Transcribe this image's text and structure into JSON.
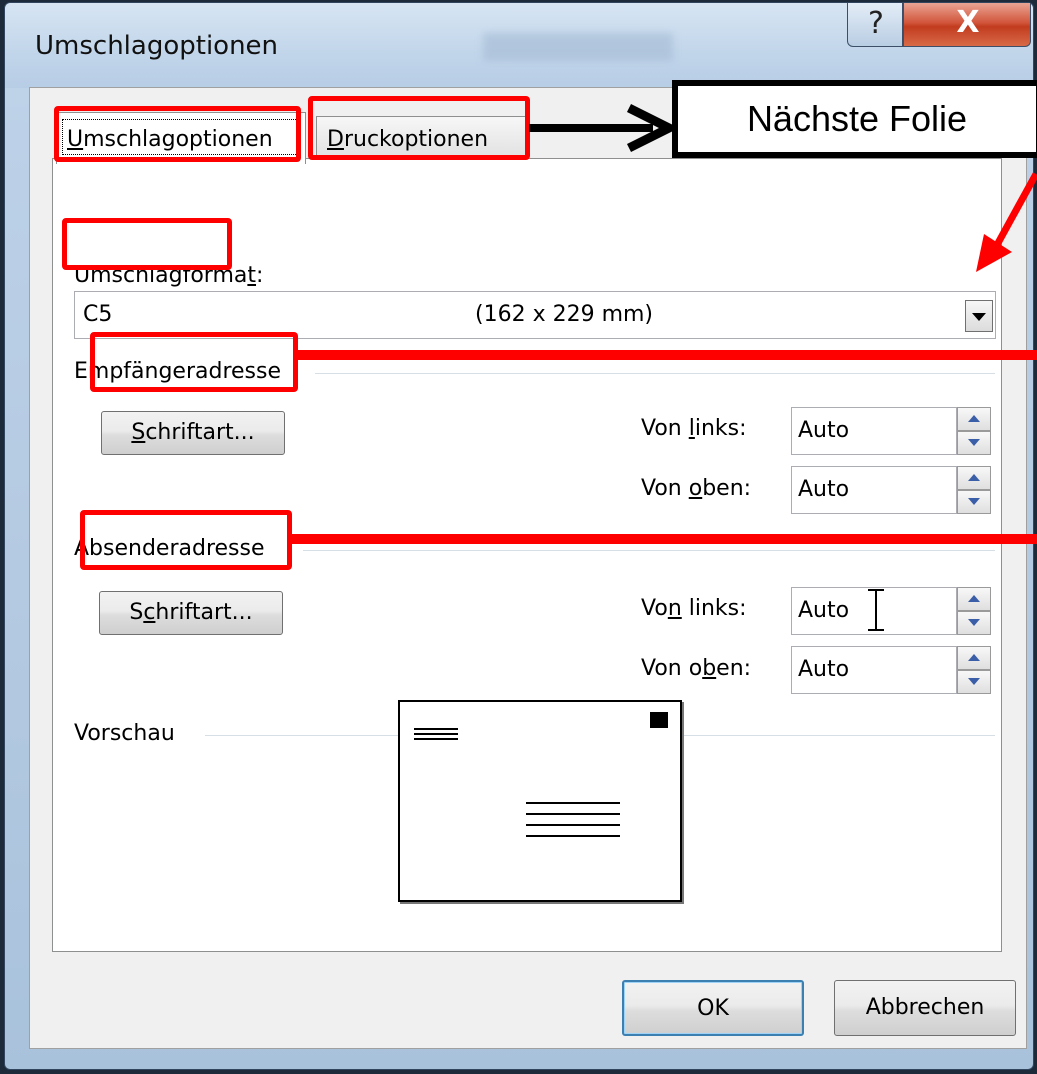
{
  "window": {
    "title": "Umschlagoptionen",
    "help_glyph": "?",
    "close_glyph": "X"
  },
  "tabs": [
    {
      "pre": "",
      "key": "U",
      "post": "mschlagoptionen",
      "active": true
    },
    {
      "pre": "",
      "key": "D",
      "post": "ruckoptionen",
      "active": false
    }
  ],
  "format": {
    "label_pre": "Umschlagforma",
    "label_key": "t",
    "label_post": ":",
    "value_name": "C5",
    "value_size": "(162 x 229 mm)"
  },
  "recipient": {
    "heading": "Empfängeradresse",
    "font_btn": {
      "pre": "",
      "key": "S",
      "post": "chriftart..."
    },
    "left_label": {
      "pre": "Von ",
      "key": "l",
      "post": "inks:"
    },
    "left_value": "Auto",
    "top_label": {
      "pre": "Von ",
      "key": "o",
      "post": "ben:"
    },
    "top_value": "Auto"
  },
  "sender": {
    "heading": "Absenderadresse",
    "font_btn": {
      "pre": "S",
      "key": "c",
      "post": "hriftart..."
    },
    "left_label": {
      "pre": "Vo",
      "key": "n",
      "post": " links:"
    },
    "left_value": "Auto",
    "top_label": {
      "pre": "Von o",
      "key": "b",
      "post": "en:"
    },
    "top_value": "Auto"
  },
  "preview": {
    "heading": "Vorschau"
  },
  "buttons": {
    "ok": "OK",
    "cancel": "Abbrechen"
  },
  "annotation": {
    "callout": "Nächste Folie",
    "highlight_color": "#ff0000"
  }
}
